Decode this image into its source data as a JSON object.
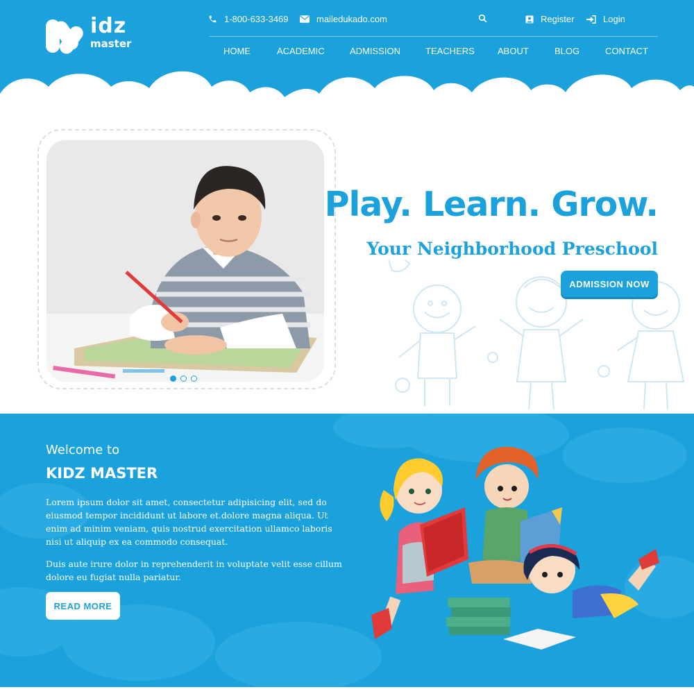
{
  "brand": {
    "logo_line1": "idz",
    "logo_line2": "master"
  },
  "topbar": {
    "phone": "1-800-633-3469",
    "email": "mailedukado.com",
    "register_label": "Register",
    "login_label": "Login"
  },
  "nav": {
    "items": [
      "HOME",
      "ACADEMIC",
      "ADMISSION",
      "TEACHERS",
      "ABOUT",
      "BLOG",
      "CONTACT"
    ]
  },
  "hero": {
    "title": "Play. Learn. Grow.",
    "subtitle": "Your Neighborhood Preschool",
    "cta_label": "ADMISSION NOW",
    "slider_total": 3,
    "slider_active": 1
  },
  "welcome": {
    "pretitle": "Welcome to",
    "title": "KIDZ MASTER",
    "paragraph1": "Lorem ipsum dolor sit amet, consectetur adipisicing elit, sed do eiusmod tempor incididunt ut labore et.dolore magna aliqua. Ut enim ad minim veniam, quis nostrud exercitation ullamco laboris nisi ut aliquip ex ea commodo consequat.",
    "paragraph2": "Duis aute irure dolor in reprehenderit in voluptate velit esse cillum dolore eu fugiat nulla pariatur.",
    "read_more_label": "READ MORE"
  },
  "colors": {
    "primary": "#1ba1dc",
    "white": "#ffffff",
    "doodle": "#cfe6f3"
  },
  "icons": [
    "phone-icon",
    "mail-icon",
    "search-icon",
    "user-icon",
    "login-icon"
  ]
}
